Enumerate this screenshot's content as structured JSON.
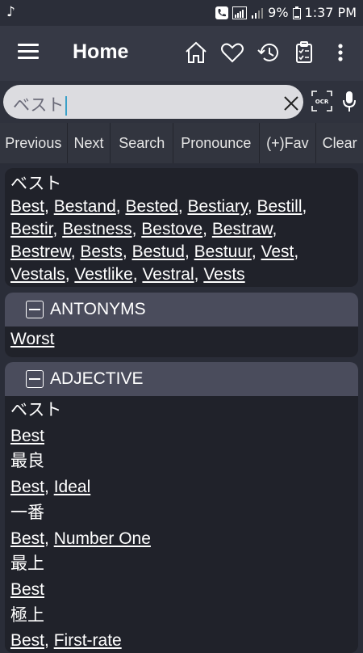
{
  "status_bar": {
    "battery": "9%",
    "time": "1:37 PM"
  },
  "toolbar": {
    "title": "Home"
  },
  "search": {
    "value": "ベスト"
  },
  "actions": [
    "Previous",
    "Next",
    "Search",
    "Pronounce",
    "(+)Fav",
    "Clear"
  ],
  "result": {
    "word": "ベスト",
    "links": [
      "Best",
      "Bestand",
      "Bested",
      "Bestiary",
      "Bestill",
      "Bestir",
      "Bestness",
      "Bestove",
      "Bestraw",
      "Bestrew",
      "Bests",
      "Bestud",
      "Bestuur",
      "Vest",
      "Vestals",
      "Vestlike",
      "Vestral",
      "Vests"
    ]
  },
  "antonyms": {
    "header": "ANTONYMS",
    "items": [
      "Worst"
    ]
  },
  "adjective": {
    "header": "ADJECTIVE",
    "entries": [
      {
        "jp": "ベスト",
        "en": [
          "Best"
        ]
      },
      {
        "jp": "最良",
        "en": [
          "Best",
          "Ideal"
        ]
      },
      {
        "jp": "一番",
        "en": [
          "Best",
          "Number One"
        ]
      },
      {
        "jp": "最上",
        "en": [
          "Best"
        ]
      },
      {
        "jp": "極上",
        "en": [
          "Best",
          "First-rate"
        ]
      }
    ]
  }
}
